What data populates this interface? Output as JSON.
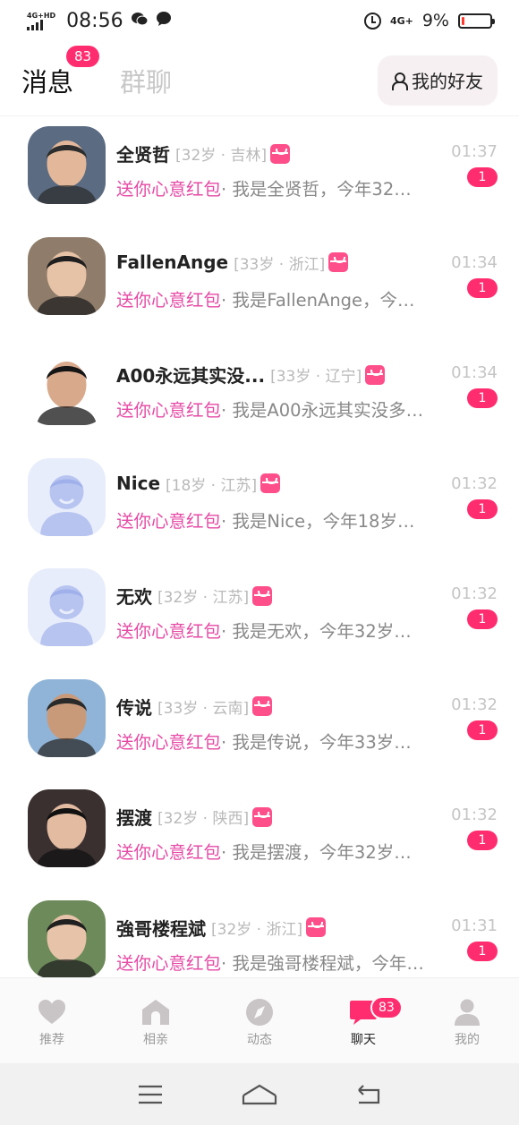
{
  "status_bar": {
    "network_left": "4G+HD",
    "time": "08:56",
    "network_right": "4G+",
    "battery_percent": "9%",
    "battery_level": 0.09
  },
  "header": {
    "tab_messages": "消息",
    "tab_messages_badge": "83",
    "tab_groups": "群聊",
    "friends_button": "我的好友"
  },
  "gift_text": "送你心意红包",
  "chats": [
    {
      "name": "全贤哲",
      "meta": "[32岁 · 吉林]",
      "preview": "· 我是全贤哲，今年32…",
      "time": "01:37",
      "unread": "1",
      "avatar": "photo"
    },
    {
      "name": "FallenAnge",
      "meta": "[33岁 · 浙江]",
      "preview": "· 我是FallenAnge，今…",
      "time": "01:34",
      "unread": "1",
      "avatar": "photo"
    },
    {
      "name": "A00永远其实没...",
      "meta": "[33岁 · 辽宁]",
      "preview": "· 我是A00永远其实没多…",
      "time": "01:34",
      "unread": "1",
      "avatar": "photo"
    },
    {
      "name": "Nice",
      "meta": "[18岁 · 江苏]",
      "preview": "· 我是Nice，今年18岁…",
      "time": "01:32",
      "unread": "1",
      "avatar": "default"
    },
    {
      "name": "无欢",
      "meta": "[32岁 · 江苏]",
      "preview": "· 我是无欢，今年32岁…",
      "time": "01:32",
      "unread": "1",
      "avatar": "default"
    },
    {
      "name": "传说",
      "meta": "[33岁 · 云南]",
      "preview": "· 我是传说，今年33岁…",
      "time": "01:32",
      "unread": "1",
      "avatar": "photo"
    },
    {
      "name": "摆渡",
      "meta": "[32岁 · 陕西]",
      "preview": "· 我是摆渡，今年32岁…",
      "time": "01:32",
      "unread": "1",
      "avatar": "photo"
    },
    {
      "name": "強哥楼程斌",
      "meta": "[32岁 · 浙江]",
      "preview": "· 我是強哥楼程斌，今年…",
      "time": "01:31",
      "unread": "1",
      "avatar": "photo"
    }
  ],
  "bottom_nav": {
    "recommend": "推荐",
    "dating": "相亲",
    "moments": "动态",
    "chat": "聊天",
    "chat_badge": "83",
    "me": "我的"
  },
  "colors": {
    "accent": "#ff2d6f",
    "gift_text": "#e64aa5",
    "default_avatar_bg": "#e8edfb"
  },
  "icons": [
    "heart-icon",
    "house-icon",
    "compass-icon",
    "chat-bubble-icon",
    "person-icon",
    "menu-icon",
    "home-icon",
    "back-icon"
  ]
}
